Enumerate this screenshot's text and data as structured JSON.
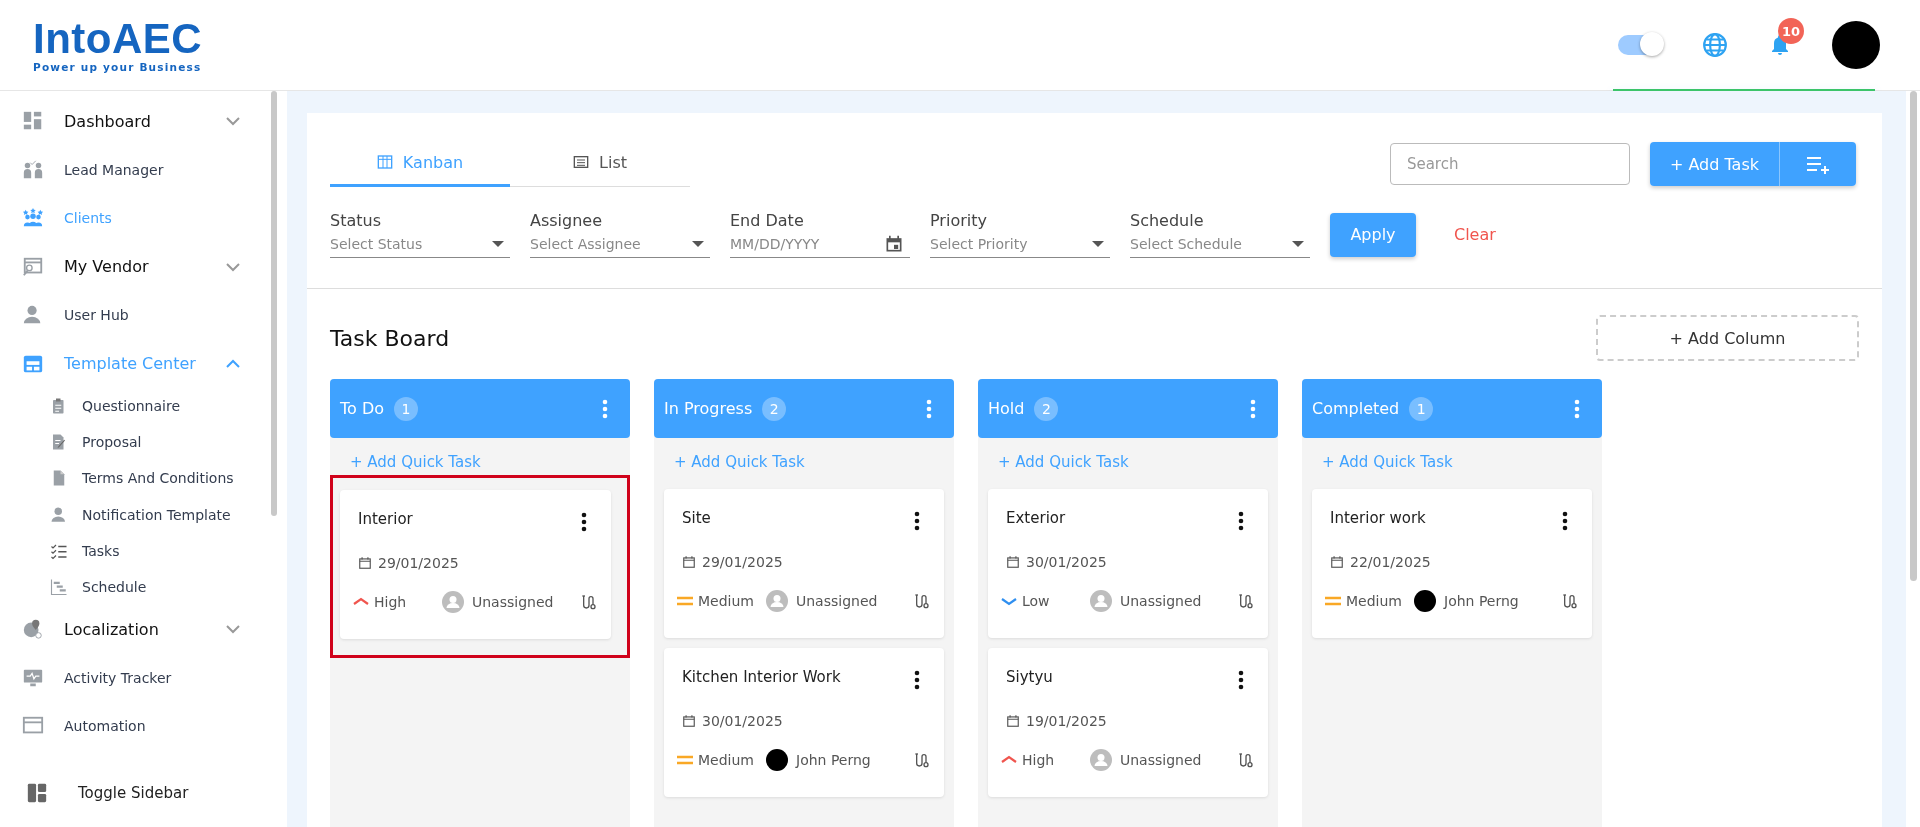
{
  "header": {
    "logo": {
      "wordmark": "IntoAEC",
      "tagline": "Power up your Business"
    },
    "theme_toggle": {
      "on": true
    },
    "notifications": {
      "count": "10"
    }
  },
  "sidebar": {
    "items": [
      {
        "label": "Dashboard",
        "selected": false,
        "expandable": true,
        "expanded": false
      },
      {
        "label": "Lead Manager",
        "selected": false,
        "expandable": false
      },
      {
        "label": "Clients",
        "selected": true,
        "expandable": false
      },
      {
        "label": "My Vendor",
        "selected": false,
        "expandable": true,
        "expanded": false
      },
      {
        "label": "User Hub",
        "selected": false,
        "expandable": false
      },
      {
        "label": "Template Center",
        "selected": true,
        "expandable": true,
        "expanded": true,
        "children": [
          {
            "label": "Questionnaire"
          },
          {
            "label": "Proposal"
          },
          {
            "label": "Terms And Conditions"
          },
          {
            "label": "Notification Template"
          },
          {
            "label": "Tasks"
          },
          {
            "label": "Schedule"
          }
        ]
      },
      {
        "label": "Localization",
        "selected": false,
        "expandable": true,
        "expanded": false
      },
      {
        "label": "Activity Tracker",
        "selected": false,
        "expandable": false
      },
      {
        "label": "Automation",
        "selected": false,
        "expandable": false
      }
    ],
    "footer": "Toggle Sidebar"
  },
  "tabs": [
    {
      "label": "Kanban",
      "selected": true
    },
    {
      "label": "List",
      "selected": false
    }
  ],
  "search": {
    "placeholder": "Search"
  },
  "add_task_button": "+ Add Task",
  "filters": [
    {
      "label": "Status",
      "placeholder": "Select Status",
      "kind": "select"
    },
    {
      "label": "Assignee",
      "placeholder": "Select Assignee",
      "kind": "select"
    },
    {
      "label": "End Date",
      "placeholder": "MM/DD/YYYY",
      "kind": "date"
    },
    {
      "label": "Priority",
      "placeholder": "Select Priority",
      "kind": "select"
    },
    {
      "label": "Schedule",
      "placeholder": "Select Schedule",
      "kind": "select"
    }
  ],
  "apply_button": "Apply",
  "clear_button": "Clear",
  "board": {
    "title": "Task Board",
    "add_column": "+ Add Column",
    "columns": [
      {
        "title": "To Do",
        "count": "1",
        "quick_add": "+ Add Quick Task",
        "tasks": [
          {
            "title": "Interior",
            "date": "29/01/2025",
            "priority": {
              "label": "High",
              "kind": "high"
            },
            "assignee": {
              "name": "Unassigned",
              "kind": "none"
            },
            "highlighted": true
          }
        ]
      },
      {
        "title": "In Progress",
        "count": "2",
        "quick_add": "+ Add Quick Task",
        "tasks": [
          {
            "title": "Site",
            "date": "29/01/2025",
            "priority": {
              "label": "Medium",
              "kind": "medium"
            },
            "assignee": {
              "name": "Unassigned",
              "kind": "none"
            },
            "highlighted": false
          },
          {
            "title": "Kitchen Interior Work",
            "date": "30/01/2025",
            "priority": {
              "label": "Medium",
              "kind": "medium"
            },
            "assignee": {
              "name": "John Perng",
              "kind": "photo"
            },
            "highlighted": false
          }
        ]
      },
      {
        "title": "Hold",
        "count": "2",
        "quick_add": "+ Add Quick Task",
        "tasks": [
          {
            "title": "Exterior",
            "date": "30/01/2025",
            "priority": {
              "label": "Low",
              "kind": "low"
            },
            "assignee": {
              "name": "Unassigned",
              "kind": "none"
            },
            "highlighted": false
          },
          {
            "title": "Siytyu",
            "date": "19/01/2025",
            "priority": {
              "label": "High",
              "kind": "high"
            },
            "assignee": {
              "name": "Unassigned",
              "kind": "none"
            },
            "highlighted": false
          }
        ]
      },
      {
        "title": "Completed",
        "count": "1",
        "quick_add": "+ Add Quick Task",
        "tasks": [
          {
            "title": "Interior work",
            "date": "22/01/2025",
            "priority": {
              "label": "Medium",
              "kind": "medium"
            },
            "assignee": {
              "name": "John Perng",
              "kind": "photo"
            },
            "highlighted": false
          }
        ]
      }
    ]
  }
}
